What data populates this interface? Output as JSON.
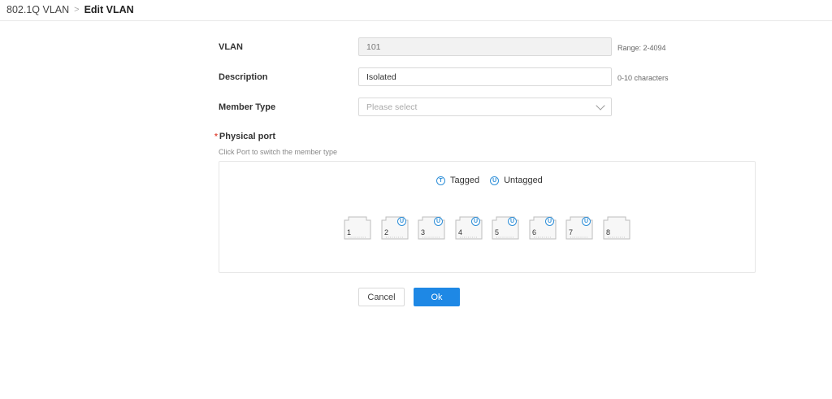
{
  "breadcrumb": {
    "parent": "802.1Q VLAN",
    "separator": ">",
    "current": "Edit VLAN"
  },
  "form": {
    "vlan": {
      "label": "VLAN",
      "value": "101",
      "hint": "Range: 2-4094"
    },
    "description": {
      "label": "Description",
      "value": "Isolated",
      "hint": "0-10 characters"
    },
    "member_type": {
      "label": "Member Type",
      "placeholder": "Please select"
    }
  },
  "physical_port": {
    "required_mark": "*",
    "label": "Physical port",
    "subtitle": "Click Port to switch the member type",
    "legend": {
      "tagged_symbol": "T",
      "tagged": "Tagged",
      "untagged_symbol": "U",
      "untagged": "Untagged"
    },
    "ports": [
      {
        "number": "1",
        "member": ""
      },
      {
        "number": "2",
        "member": "U"
      },
      {
        "number": "3",
        "member": "U"
      },
      {
        "number": "4",
        "member": "U"
      },
      {
        "number": "5",
        "member": "U"
      },
      {
        "number": "6",
        "member": "U"
      },
      {
        "number": "7",
        "member": "U"
      },
      {
        "number": "8",
        "member": ""
      }
    ]
  },
  "buttons": {
    "cancel": "Cancel",
    "ok": "Ok"
  },
  "colors": {
    "accent": "#1e88e5",
    "badge": "#2f8fd8",
    "required": "#e0493b"
  }
}
